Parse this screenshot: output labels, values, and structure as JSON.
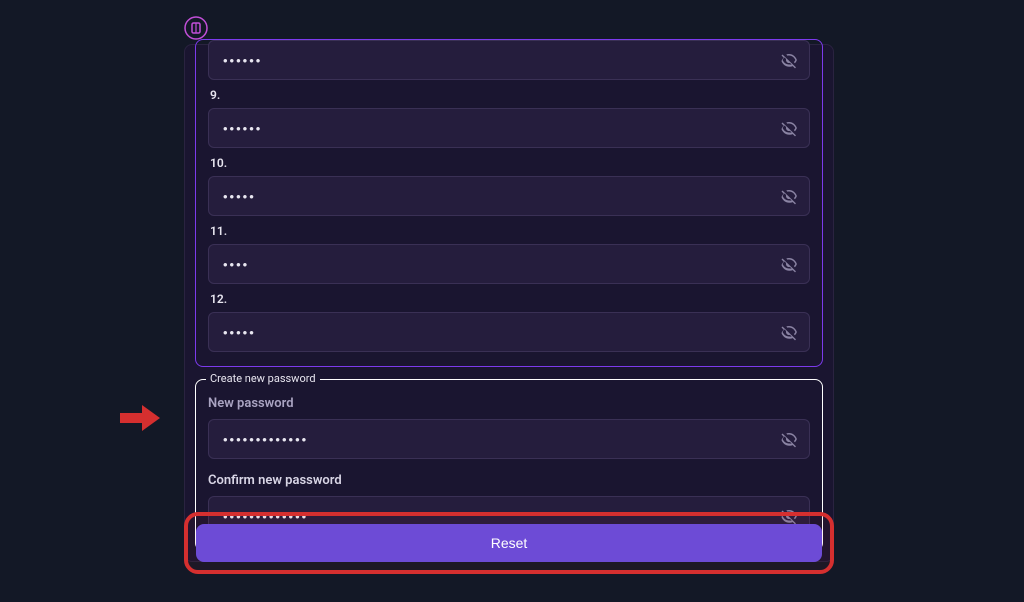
{
  "seed": {
    "rows": [
      {
        "label": "",
        "value": "••••••"
      },
      {
        "label": "9.",
        "value": "••••••"
      },
      {
        "label": "10.",
        "value": "•••••"
      },
      {
        "label": "11.",
        "value": "••••"
      },
      {
        "label": "12.",
        "value": "•••••"
      }
    ]
  },
  "password_box": {
    "legend": "Create new password",
    "new_label": "New password",
    "new_value": "•••••••••••••",
    "confirm_label": "Confirm new password",
    "confirm_value": "•••••••••••••"
  },
  "reset_label": "Reset",
  "colors": {
    "accent": "#6d4bd6",
    "seed_border": "#7c3aed",
    "highlight": "#d52f2f",
    "bg": "#131826",
    "card": "#1a1530"
  }
}
